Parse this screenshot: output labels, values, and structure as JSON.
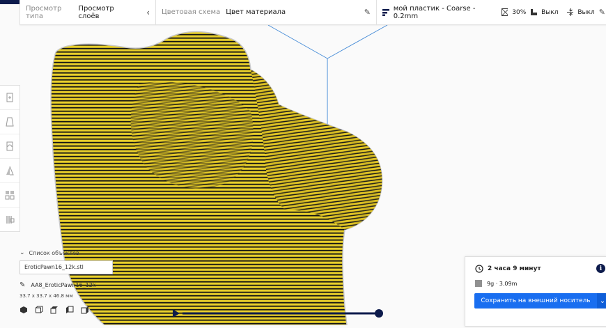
{
  "toolbar": {
    "view_type_label": "Просмотр типа",
    "view_type_value": "Просмотр слоёв",
    "color_scheme_label": "Цветовая схема",
    "color_scheme_value": "Цвет материала",
    "print_profile": "мой пластик - Coarse - 0.2mm",
    "infill": "30%",
    "support": "Выкл",
    "adhesion": "Выкл"
  },
  "left_tools": [
    "move-tool-icon",
    "scale-tool-icon",
    "rotate-tool-icon",
    "mirror-tool-icon",
    "per-model-settings-icon",
    "support-blocker-icon"
  ],
  "object_list": {
    "header": "Список объектов",
    "selected_item": "EroticPawn16_12k.stl",
    "object_name": "AA8_EroticPawn16_12k",
    "dimensions": "33.7 x 33.7 x 46.8 мм"
  },
  "print_panel": {
    "time": "2 часа 9 минут",
    "material": "9g · 3.09m",
    "save_label": "Сохранить на внешний носитель"
  },
  "layer_slider": {
    "value": 1.0
  },
  "colors": {
    "model": "#e8cf2a",
    "accent": "#196ef0",
    "dark": "#0d1b4c"
  }
}
